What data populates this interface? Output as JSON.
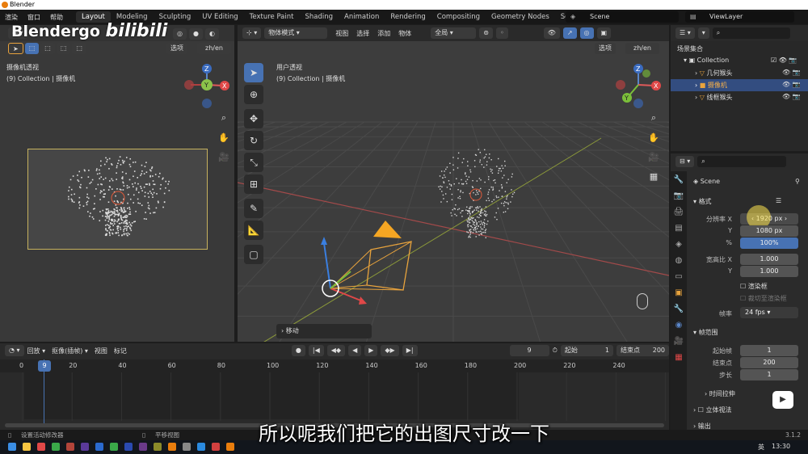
{
  "window": {
    "title": "Blender"
  },
  "menu": {
    "items": [
      "渲染",
      "窗口",
      "帮助"
    ],
    "tabs": [
      "Layout",
      "Modeling",
      "Sculpting",
      "UV Editing",
      "Texture Paint",
      "Shading",
      "Animation",
      "Rendering",
      "Compositing",
      "Geometry Nodes",
      "Scripting"
    ],
    "active_tab": "Layout",
    "scene": "Scene",
    "view_layer": "ViewLayer"
  },
  "watermark": {
    "text": "Blendergo",
    "bili": "bilibili"
  },
  "left_viewport": {
    "options_label": "选项",
    "lang_btn": "zh/en",
    "view_name": "摄像机透视",
    "collection_info": "(9) Collection | 摄像机"
  },
  "center_viewport": {
    "mode": "物体模式",
    "menus": [
      "视图",
      "选择",
      "添加",
      "物体"
    ],
    "orientation": "全局",
    "options_label": "选项",
    "lang_btn": "zh/en",
    "view_name": "用户透视",
    "collection_info": "(9) Collection | 摄像机",
    "last_op": "移动"
  },
  "axes": {
    "x": "X",
    "y": "Y",
    "z": "Z"
  },
  "outliner": {
    "root": "场景集合",
    "collection": "Collection",
    "items": [
      {
        "label": "几何猴头"
      },
      {
        "label": "摄像机"
      },
      {
        "label": "线框猴头"
      }
    ]
  },
  "properties": {
    "context": "Scene",
    "format_panel": "格式",
    "res_x_label": "分辨率 X",
    "res_x": "1920 px",
    "res_y_label": "Y",
    "res_y": "1080 px",
    "res_pct_label": "%",
    "res_pct": "100%",
    "aspect_x_label": "宽高比 X",
    "aspect_x": "1.000",
    "aspect_y_label": "Y",
    "aspect_y": "1.000",
    "render_region": "渲染框",
    "crop_region": "裁切至渲染框",
    "fps_label": "帧率",
    "fps": "24 fps",
    "frame_range_panel": "帧范围",
    "frame_start_label": "起始帧",
    "frame_start": "1",
    "frame_end_label": "结束点",
    "frame_end": "200",
    "frame_step_label": "步长",
    "frame_step": "1",
    "time_stretch": "时间拉伸",
    "stereoscopy": "立体视法",
    "output_panel": "输出"
  },
  "timeline": {
    "menus": [
      "回放",
      "抠像(插帧)",
      "视图",
      "标记"
    ],
    "current_frame": "9",
    "start_label": "起始",
    "start": "1",
    "end_label": "结束点",
    "end": "200",
    "ticks": [
      "0",
      "20",
      "40",
      "60",
      "80",
      "100",
      "120",
      "140",
      "160",
      "180",
      "200",
      "220",
      "240"
    ],
    "current_ticks": "9"
  },
  "status": {
    "left": "设置活动修改器",
    "middle": "平移视图",
    "version": "3.1.2"
  },
  "taskbar": {
    "time": "13:30",
    "lang": "英"
  },
  "subtitle": "所以呢我们把它的出图尺寸改一下"
}
